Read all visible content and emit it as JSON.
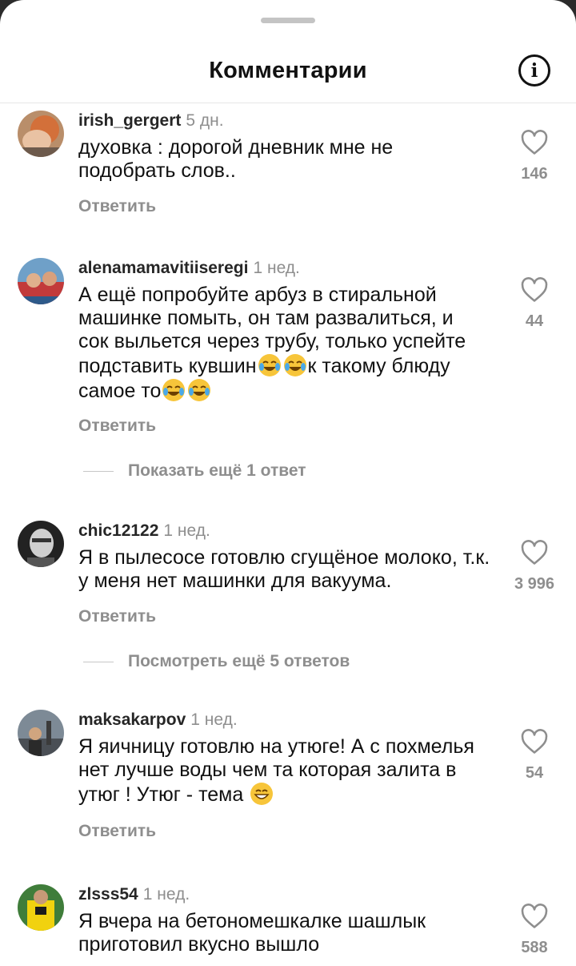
{
  "header": {
    "title": "Комментарии",
    "info_icon": "info-icon"
  },
  "comments": [
    {
      "username": "irish_gergert",
      "time": "5 дн.",
      "text": "духовка : дорогой дневник мне не подобрать слов..",
      "likes": "146",
      "reply_label": "Ответить"
    },
    {
      "username": "alenamamavitiiseregi",
      "time": "1 нед.",
      "text_parts": [
        "А ещё попробуйте арбуз в стиральной машинке помыть, он там развалиться, и сок выльется через трубу, только успейте подставить кувшин",
        "к такому блюду самое то"
      ],
      "likes": "44",
      "reply_label": "Ответить",
      "more_replies": "Показать ещё 1 ответ"
    },
    {
      "username": "chic12122",
      "time": "1 нед.",
      "text": "Я в пылесосе готовлю сгущёное молоко, т.к. у меня нет машинки для вакуума.",
      "likes": "3 996",
      "reply_label": "Ответить",
      "more_replies": "Посмотреть ещё 5 ответов"
    },
    {
      "username": "maksakarpov",
      "time": "1 нед.",
      "text": "Я яичницу готовлю на утюге! А с похмелья нет лучше воды чем та которая залита в утюг ! Утюг - тема",
      "likes": "54",
      "reply_label": "Ответить"
    },
    {
      "username": "zlsss54",
      "time": "1 нед.",
      "text": "Я вчера на бетономешкалке шашлык приготовил вкусно вышло",
      "likes": "588"
    }
  ],
  "emoji": {
    "laugh": "face-with-tears-of-joy",
    "grin": "grinning-face"
  },
  "colors": {
    "muted": "#8e8e8e",
    "text": "#111111"
  }
}
